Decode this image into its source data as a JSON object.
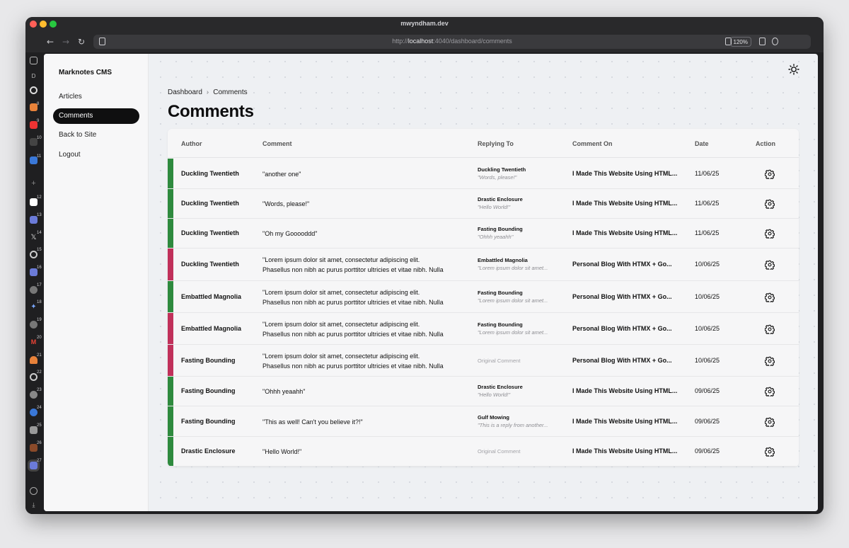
{
  "window": {
    "title": "mwyndham.dev"
  },
  "browser": {
    "url_prefix": "http://",
    "url_host": "localhost",
    "url_rest": ":4040/dashboard/comments",
    "zoom": "120%"
  },
  "rail": {
    "letter": "D",
    "numbers": [
      "8",
      "9",
      "10",
      "11",
      "12",
      "13",
      "14",
      "15",
      "16",
      "17",
      "18",
      "19",
      "20",
      "21",
      "22",
      "23",
      "24",
      "25",
      "26",
      "27"
    ]
  },
  "sidebar": {
    "brand": "Marknotes CMS",
    "items": [
      {
        "label": "Articles"
      },
      {
        "label": "Comments"
      },
      {
        "label": "Back to Site"
      },
      {
        "label": "Logout"
      }
    ]
  },
  "breadcrumb": {
    "root": "Dashboard",
    "current": "Comments"
  },
  "page": {
    "title": "Comments"
  },
  "table": {
    "headers": {
      "author": "Author",
      "comment": "Comment",
      "replying_to": "Replying To",
      "comment_on": "Comment On",
      "date": "Date",
      "action": "Action"
    },
    "rows": [
      {
        "author": "Duckling Twentieth",
        "comment_l1": "\"another one\"",
        "comment_l2": "",
        "reply_name": "Duckling Twentieth",
        "reply_quote": "\"Words, please!\"",
        "reply_orig": "",
        "on": "I Made This Website Using HTML...",
        "date": "11/06/25",
        "status_color": "#2e8a3e"
      },
      {
        "author": "Duckling Twentieth",
        "comment_l1": "\"Words, please!\"",
        "comment_l2": "",
        "reply_name": "Drastic Enclosure",
        "reply_quote": "\"Hello World!\"",
        "reply_orig": "",
        "on": "I Made This Website Using HTML...",
        "date": "11/06/25",
        "status_color": "#2e8a3e"
      },
      {
        "author": "Duckling Twentieth",
        "comment_l1": "\"Oh my Gooooddd\"",
        "comment_l2": "",
        "reply_name": "Fasting Bounding",
        "reply_quote": "\"Ohhh yeaahh\"",
        "reply_orig": "",
        "on": "I Made This Website Using HTML...",
        "date": "11/06/25",
        "status_color": "#2e8a3e"
      },
      {
        "author": "Duckling Twentieth",
        "comment_l1": "\"Lorem ipsum dolor sit amet, consectetur adipiscing elit.",
        "comment_l2": "Phasellus non nibh ac purus porttitor ultricies et vitae nibh. Nulla",
        "reply_name": "Embattled Magnolia",
        "reply_quote": "\"Lorem ipsum dolor sit amet...",
        "reply_orig": "",
        "on": "Personal Blog With HTMX + Go...",
        "date": "10/06/25",
        "status_color": "#c0305a"
      },
      {
        "author": "Embattled Magnolia",
        "comment_l1": "\"Lorem ipsum dolor sit amet, consectetur adipiscing elit.",
        "comment_l2": "Phasellus non nibh ac purus porttitor ultricies et vitae nibh. Nulla",
        "reply_name": "Fasting Bounding",
        "reply_quote": "\"Lorem ipsum dolor sit amet...",
        "reply_orig": "",
        "on": "Personal Blog With HTMX + Go...",
        "date": "10/06/25",
        "status_color": "#2e8a3e"
      },
      {
        "author": "Embattled Magnolia",
        "comment_l1": "\"Lorem ipsum dolor sit amet, consectetur adipiscing elit.",
        "comment_l2": "Phasellus non nibh ac purus porttitor ultricies et vitae nibh. Nulla",
        "reply_name": "Fasting Bounding",
        "reply_quote": "\"Lorem ipsum dolor sit amet...",
        "reply_orig": "",
        "on": "Personal Blog With HTMX + Go...",
        "date": "10/06/25",
        "status_color": "#c0305a"
      },
      {
        "author": "Fasting Bounding",
        "comment_l1": "\"Lorem ipsum dolor sit amet, consectetur adipiscing elit.",
        "comment_l2": "Phasellus non nibh ac purus porttitor ultricies et vitae nibh. Nulla",
        "reply_name": "",
        "reply_quote": "",
        "reply_orig": "Original Comment",
        "on": "Personal Blog With HTMX + Go...",
        "date": "10/06/25",
        "status_color": "#c0305a"
      },
      {
        "author": "Fasting Bounding",
        "comment_l1": "\"Ohhh yeaahh\"",
        "comment_l2": "",
        "reply_name": "Drastic Enclosure",
        "reply_quote": "\"Hello World!\"",
        "reply_orig": "",
        "on": "I Made This Website Using HTML...",
        "date": "09/06/25",
        "status_color": "#2e8a3e"
      },
      {
        "author": "Fasting Bounding",
        "comment_l1": "\"This as well! Can't you believe it?!\"",
        "comment_l2": "",
        "reply_name": "Gulf Mowing",
        "reply_quote": "\"This is a reply from another...",
        "reply_orig": "",
        "on": "I Made This Website Using HTML...",
        "date": "09/06/25",
        "status_color": "#2e8a3e"
      },
      {
        "author": "Drastic Enclosure",
        "comment_l1": "\"Hello World!\"",
        "comment_l2": "",
        "reply_name": "",
        "reply_quote": "",
        "reply_orig": "Original Comment",
        "on": "I Made This Website Using HTML...",
        "date": "09/06/25",
        "status_color": "#2e8a3e"
      }
    ]
  }
}
